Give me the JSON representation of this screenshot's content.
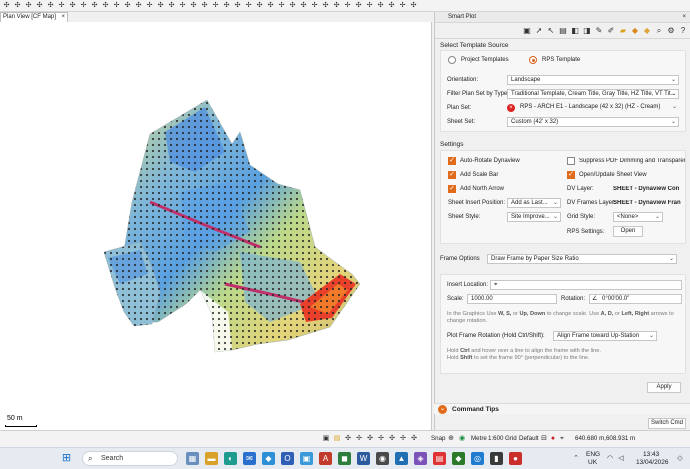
{
  "toolbar": {
    "icon_count": 40
  },
  "plan_view": {
    "tab_title": "Plan View [CF Map]",
    "tab_close": "×",
    "scale_bar_label": "50 m"
  },
  "panel": {
    "title": "Smart Plot",
    "close": "×",
    "select_template": {
      "section_title": "Select Template Source",
      "option_project": "Project Templates",
      "option_rps": "RPS Template",
      "orientation_label": "Orientation:",
      "orientation_value": "Landscape",
      "filter_label": "Filter Plan Set by Type:",
      "filter_value": "Traditional Template, Cream Title, Gray Title, HZ Title, VT Tit...",
      "plan_set_label": "Plan Set:",
      "plan_set_value": "RPS - ARCH E1 - Landscape (42 x 32) (HZ - Cream)",
      "sheet_set_label": "Sheet Set:",
      "sheet_set_value": "Custom (42' x 32)"
    },
    "settings": {
      "section_title": "Settings",
      "auto_rotate": "Auto-Rotate Dynaview",
      "suppress_pdf": "Suppress PDF Dimming and Transparen",
      "add_scale_bar": "Add Scale Bar",
      "open_update": "Open/Update Sheet View",
      "add_north_arrow": "Add North Arrow",
      "dv_layer_label": "DV Layer:",
      "dv_layer_value": "SHEET - Dynaview Con",
      "insert_position_label": "Sheet Insert Position:",
      "insert_position_value": "Add as Last...",
      "dv_frames_label": "DV Frames Layer:",
      "dv_frames_value": "SHEET - Dynaview Fran",
      "sheet_style_label": "Sheet Style:",
      "sheet_style_value": "Site Improve...",
      "grid_style_label": "Grid Style:",
      "grid_style_value": "<None>",
      "rps_settings_label": "RPS Settings:",
      "open_button": "Open"
    },
    "frame": {
      "options_label": "Frame Options",
      "options_value": "Draw Frame by Paper Size Ratio",
      "insert_location_label": "Insert Location:",
      "scale_label": "Scale:",
      "scale_value": "1000.00",
      "rotation_label": "Rotation:",
      "rotation_value": "0°00'00.0\"",
      "hint_1a": "In the Graphics Use ",
      "hint_1b": "W, S,",
      "hint_1c": " or ",
      "hint_1d": "Up, Down",
      "hint_1e": " to change scale. Use ",
      "hint_1f": "A, D,",
      "hint_1g": " or ",
      "hint_1h": "Left, Right",
      "hint_1i": " arrows to",
      "hint_1j": "change rotation.",
      "rotation_mode_label": "Plot Frame Rotation (Hold Ctrl/Shift):",
      "rotation_mode_value": "Align Frame toward Up-Station",
      "hint_2a": "Hold ",
      "hint_2b": "Ctrl",
      "hint_2c": " and hover over a line to align the frame with the line.",
      "hint_3a": "Hold ",
      "hint_3b": "Shift",
      "hint_3c": " to set the frame 90° (perpendicular) to the line."
    },
    "apply_button": "Apply",
    "command_tips": "Command Tips",
    "switch_cmd": "Switch Cmd"
  },
  "statusbar": {
    "snap": "Snap",
    "units": "Metre",
    "scale": "1:600",
    "grid": "Grid",
    "default": "Default",
    "coords": "640.680 m,608.931 m"
  },
  "taskbar": {
    "search_placeholder": "Search",
    "lang": "ENG",
    "region": "UK",
    "time": "13:43",
    "date": "13/04/2026"
  }
}
